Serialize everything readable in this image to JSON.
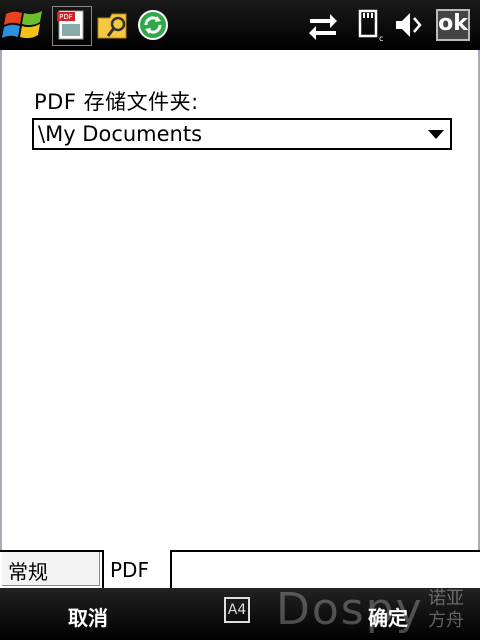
{
  "statusbar": {
    "icons": [
      "windows-start-icon",
      "pdf-app-icon",
      "file-explorer-icon",
      "sync-icon",
      "connectivity-icon",
      "sd-card-icon",
      "volume-muted-icon"
    ],
    "ok_label": "ok"
  },
  "form": {
    "folder_label": "PDF 存储文件夹:",
    "folder_value": "\\My Documents"
  },
  "tabs": [
    {
      "label": "常规"
    },
    {
      "label": "PDF"
    }
  ],
  "softkeys": {
    "left": "取消",
    "center_icon_label": "A4",
    "right": "确定"
  },
  "watermark": {
    "text": "Dospy",
    "cn_line1": "诺亚",
    "cn_line2": "方舟"
  }
}
